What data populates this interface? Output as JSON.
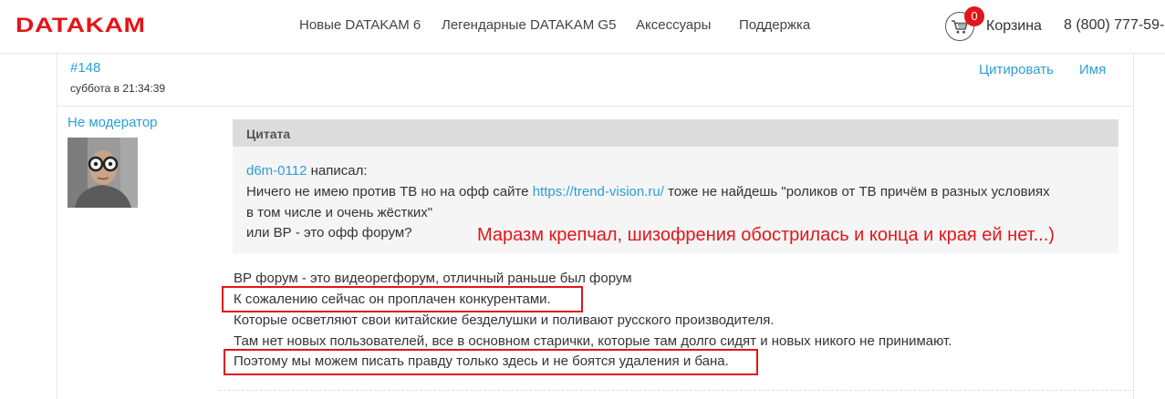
{
  "header": {
    "logo": "DATAKAM",
    "nav": [
      "Новые DATAKAM 6",
      "Легендарные DATAKAM G5",
      "Аксессуары",
      "Поддержка"
    ],
    "cart_count": "0",
    "cart_label": "Корзина",
    "phone": "8 (800) 777-59-"
  },
  "post": {
    "number": "#148",
    "date": "суббота в 21:34:39",
    "actions": [
      "Цитировать",
      "Имя"
    ],
    "author_role": "Не модератор",
    "quote": {
      "title": "Цитата",
      "author": "d6m-0112",
      "wrote": " написал:",
      "line1_before": "Ничего не имею против ТВ но на офф сайте ",
      "line1_link": "https://trend-vision.ru/",
      "line1_after": " тоже не найдешь \"роликов от ТВ причём в разных условиях",
      "line2": "в том числе и очень жёстких\"",
      "line3": "или ВР - это офф форум?"
    },
    "annotation": "Маразм крепчал, шизофрения обострилась и конца и края ей нет...)",
    "body": [
      "ВР форум - это видеорегфорум, отличный раньше был форум",
      "К сожалению сейчас он проплачен конкурентами.",
      "Которые осветляют свои китайские безделушки и поливают русского производителя.",
      "Там нет новых пользователей, все в основном старички, которые там долго сидят и новых никого не принимают.",
      "Поэтому мы можем писать правду только здесь и не боятся удаления и бана."
    ]
  },
  "colors": {
    "brand_red": "#e3151a",
    "link_blue": "#2a9fd6",
    "quote_bg": "#f5f5f5",
    "quote_head_bg": "#dcdcdc"
  }
}
